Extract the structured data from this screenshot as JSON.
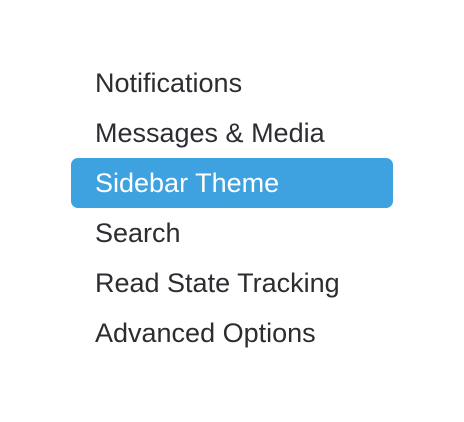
{
  "menu": {
    "items": [
      {
        "label": "Notifications",
        "selected": false
      },
      {
        "label": "Messages & Media",
        "selected": false
      },
      {
        "label": "Sidebar Theme",
        "selected": true
      },
      {
        "label": "Search",
        "selected": false
      },
      {
        "label": "Read State Tracking",
        "selected": false
      },
      {
        "label": "Advanced Options",
        "selected": false
      }
    ],
    "selected_color": "#3ea2e0",
    "text_color": "#2c2d30"
  }
}
